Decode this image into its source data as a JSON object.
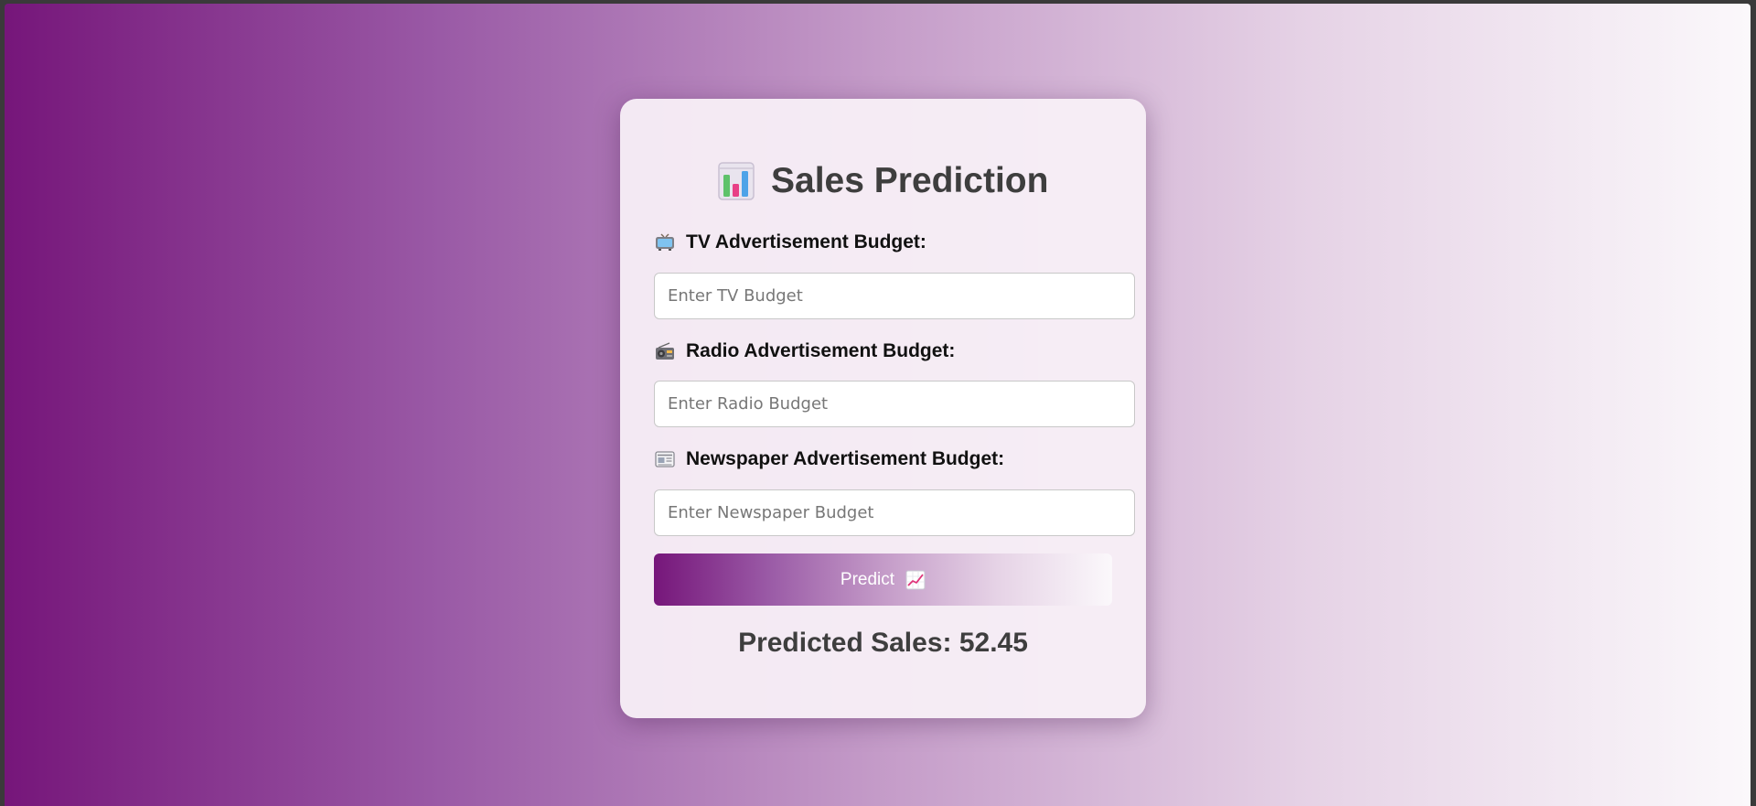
{
  "page": {
    "title": "Sales Prediction",
    "title_icon": "bar-chart-icon"
  },
  "form": {
    "tv": {
      "label": "TV Advertisement Budget:",
      "icon": "television-icon",
      "placeholder": "Enter TV Budget",
      "value": ""
    },
    "radio": {
      "label": "Radio Advertisement Budget:",
      "icon": "radio-icon",
      "placeholder": "Enter Radio Budget",
      "value": ""
    },
    "newspaper": {
      "label": "Newspaper Advertisement Budget:",
      "icon": "newspaper-icon",
      "placeholder": "Enter Newspaper Budget",
      "value": ""
    },
    "predict_label": "Predict",
    "predict_icon": "chart-increasing-icon"
  },
  "result": {
    "text": "Predicted Sales: 52.45"
  },
  "colors": {
    "gradient_start": "#76167a",
    "gradient_end": "#fbf8fb",
    "card_background": "#f7eff5",
    "title_text": "#3e3e3e"
  }
}
